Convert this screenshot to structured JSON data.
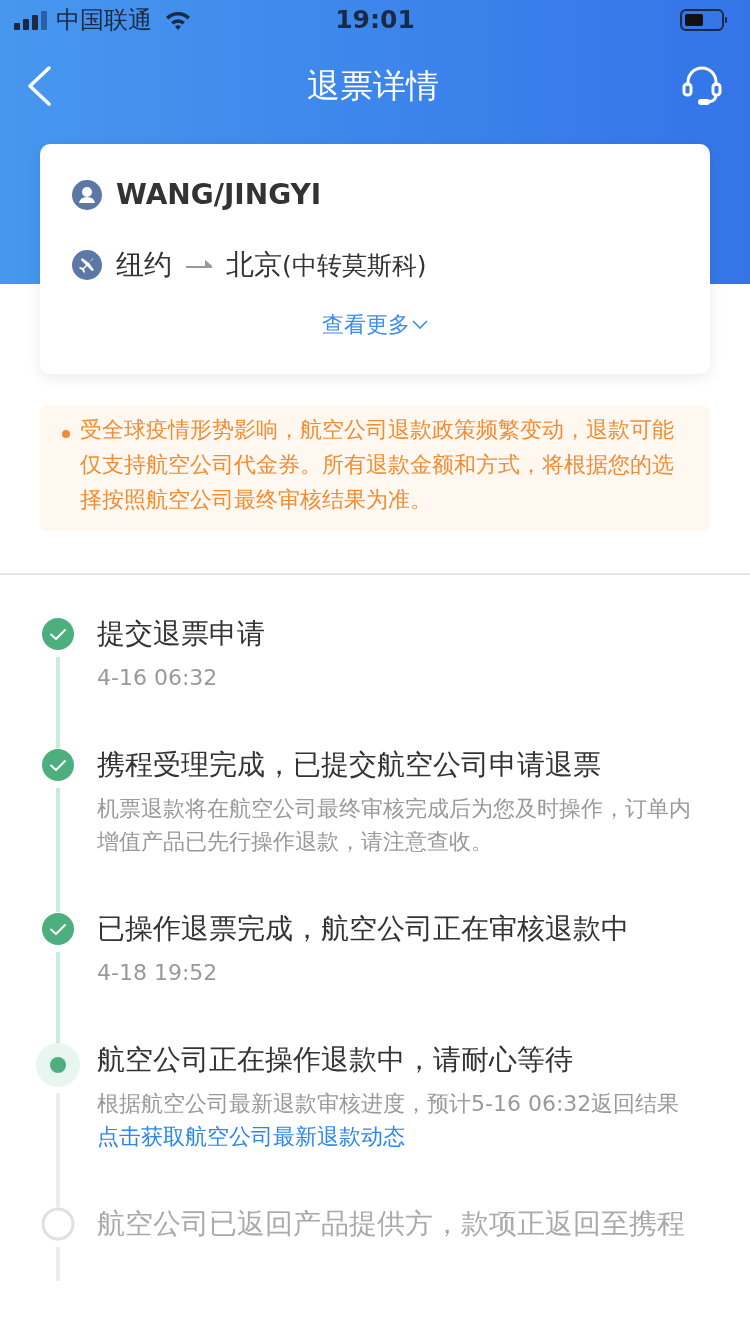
{
  "status_bar": {
    "carrier": "中国联通",
    "time": "19:01"
  },
  "nav": {
    "title": "退票详情"
  },
  "ticket": {
    "passenger": "WANG/JINGYI",
    "origin": "纽约",
    "destination": "北京",
    "transit": "(中转莫斯科)",
    "more": "查看更多"
  },
  "notice": {
    "text": "受全球疫情形势影响，航空公司退款政策频繁变动，退款可能仅支持航空公司代金券。所有退款金额和方式，将根据您的选择按照航空公司最终审核结果为准。"
  },
  "steps": [
    {
      "kind": "done",
      "title": "提交退票申请",
      "detail": "4-16 06:32"
    },
    {
      "kind": "done",
      "title": "携程受理完成，已提交航空公司申请退票",
      "detail": "机票退款将在航空公司最终审核完成后为您及时操作，订单内增值产品已先行操作退款，请注意查收。"
    },
    {
      "kind": "done",
      "title": "已操作退票完成，航空公司正在审核退款中",
      "detail": "4-18 19:52"
    },
    {
      "kind": "current",
      "title": "航空公司正在操作退款中，请耐心等待",
      "detail": "根据航空公司最新退款审核进度，预计5-16 06:32返回结果",
      "link": "点击获取航空公司最新退款动态"
    },
    {
      "kind": "pending",
      "title": "航空公司已返回产品提供方，款项正返回至携程"
    }
  ]
}
